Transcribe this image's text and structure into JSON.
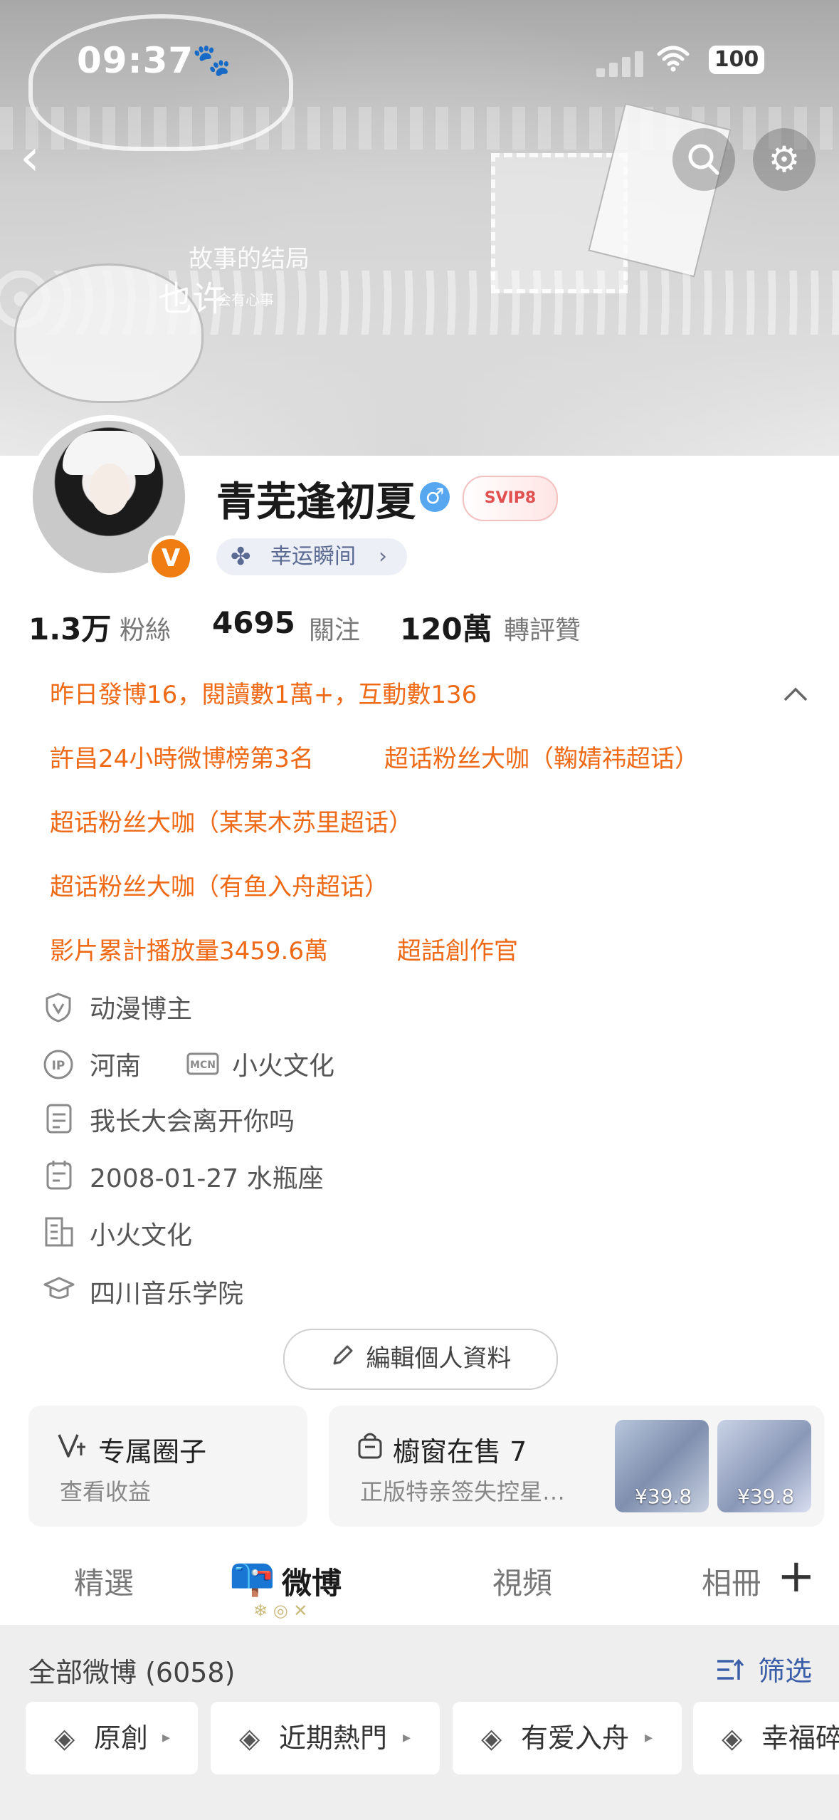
{
  "status_bar": {
    "time": "09:37",
    "battery": "100"
  },
  "banner": {
    "line1": "故事的结局",
    "line2": "也许",
    "line3": "会有心事"
  },
  "profile": {
    "username": "青芜逢初夏",
    "gender_symbol": "♂",
    "vip_badge": "SVIP8",
    "verified_badge": "V",
    "luck_label": "幸运瞬间",
    "stats": [
      {
        "value": "1.3万",
        "label": "粉絲"
      },
      {
        "value": "4695",
        "label": "關注"
      },
      {
        "value": "120萬",
        "label": "轉評贊"
      }
    ]
  },
  "highlights": {
    "yesterday": "昨日發博16，閱讀數1萬+，互動數136",
    "row1": [
      "許昌24小時微博榜第3名",
      "超话粉丝大咖（鞠婧祎超话）"
    ],
    "row2": [
      "超话粉丝大咖（某某木苏里超话）"
    ],
    "row3": [
      "超话粉丝大咖（有鱼入舟超话）"
    ],
    "row4": [
      "影片累計播放量3459.6萬",
      "超話創作官"
    ]
  },
  "info": {
    "category": "动漫博主",
    "location": "河南",
    "ip_icon": "IP",
    "mcn_icon": "MCN",
    "mcn": "小火文化",
    "bio": "我长大会离开你吗",
    "birthday": "2008-01-27 水瓶座",
    "company": "小火文化",
    "school": "四川音乐学院"
  },
  "edit_button": "編輯個人資料",
  "cards": {
    "circle_title": "专属圈子",
    "circle_sub": "查看收益",
    "shop_title": "櫥窗在售 7",
    "shop_sub": "正版特亲签失控星…",
    "price1": "¥39.8",
    "price2": "¥39.8"
  },
  "tabs": [
    "精選",
    "微博",
    "視頻",
    "相冊"
  ],
  "feed": {
    "all_label": "全部微博 (6058)",
    "filter_label": "筛选",
    "chips": [
      "原創",
      "近期熱門",
      "有爱入舟",
      "幸福碎"
    ]
  },
  "icons": {
    "back": "back-arrow-icon",
    "search": "search-icon",
    "settings": "gear-icon",
    "luck": "clover-icon",
    "plus": "plus-icon"
  },
  "colors": {
    "accent_orange": "#ef6a17",
    "link_blue": "#3a5ea8",
    "verified_orange": "#f07d12",
    "male_blue": "#57a7f0"
  }
}
